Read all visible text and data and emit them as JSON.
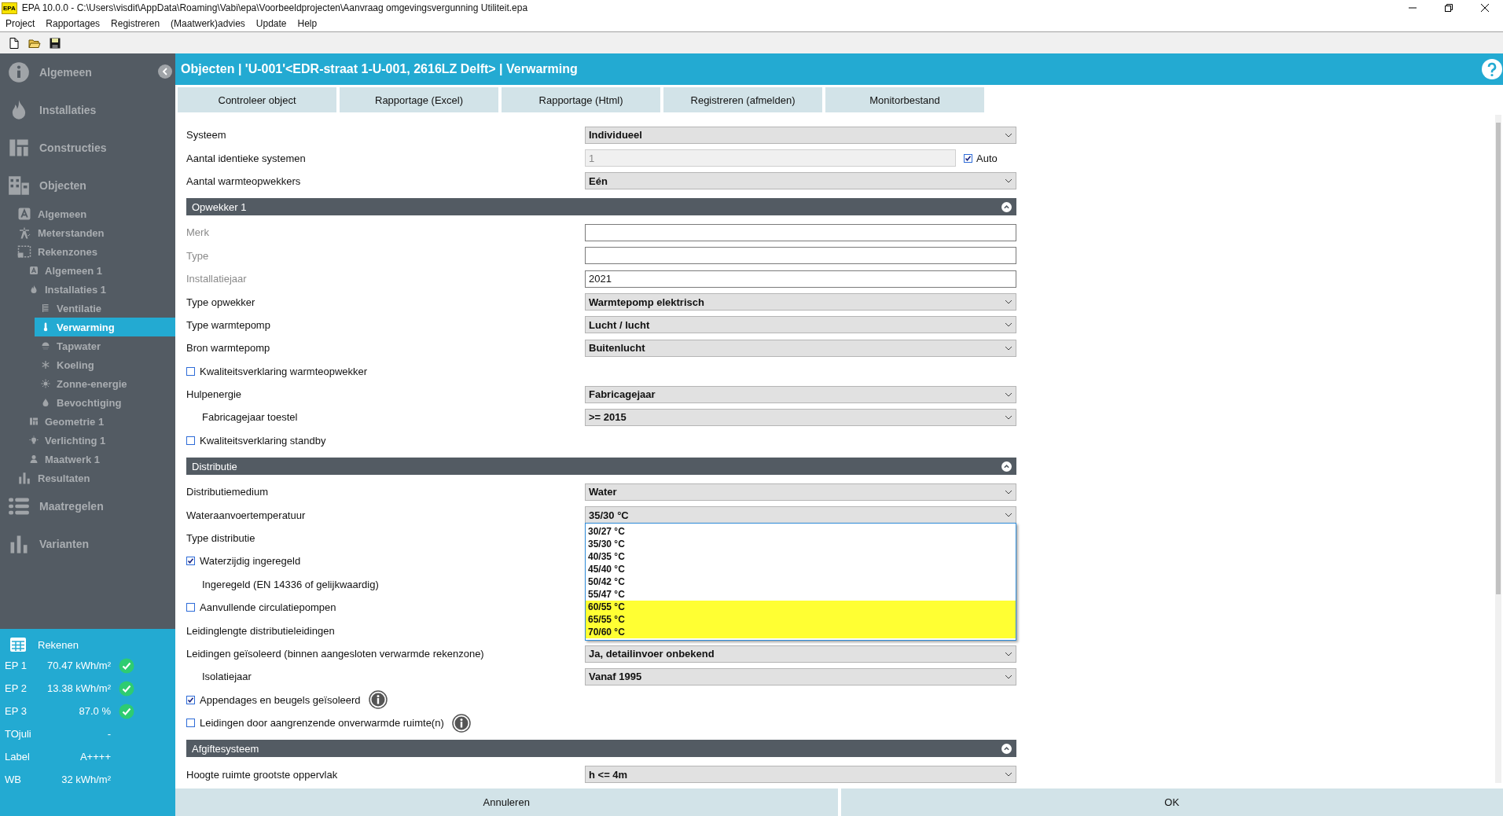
{
  "window": {
    "app_badge": "EPA",
    "title": "EPA 10.0.0 - C:\\Users\\visdit\\AppData\\Roaming\\Vabi\\epa\\Voorbeeldprojecten\\Aanvraag omgevingsvergunning Utiliteit.epa"
  },
  "menu": [
    "Project",
    "Rapportages",
    "Registreren",
    "(Maatwerk)advies",
    "Update",
    "Help"
  ],
  "sidebar": {
    "items": [
      {
        "label": "Algemeen",
        "selected": false
      },
      {
        "label": "Installaties",
        "selected": false
      },
      {
        "label": "Constructies",
        "selected": false
      },
      {
        "label": "Objecten",
        "selected": false,
        "children": [
          {
            "label": "Algemeen",
            "selected": false
          },
          {
            "label": "Meterstanden",
            "selected": false
          },
          {
            "label": "Rekenzones",
            "selected": false,
            "children": [
              {
                "label": "Algemeen 1",
                "selected": false
              },
              {
                "label": "Installaties 1",
                "selected": false,
                "children": [
                  {
                    "label": "Ventilatie",
                    "selected": false
                  },
                  {
                    "label": "Verwarming",
                    "selected": true
                  },
                  {
                    "label": "Tapwater",
                    "selected": false
                  },
                  {
                    "label": "Koeling",
                    "selected": false
                  },
                  {
                    "label": "Zonne-energie",
                    "selected": false
                  },
                  {
                    "label": "Bevochtiging",
                    "selected": false
                  }
                ]
              },
              {
                "label": "Geometrie 1",
                "selected": false
              },
              {
                "label": "Verlichting 1",
                "selected": false
              },
              {
                "label": "Maatwerk 1",
                "selected": false
              }
            ]
          },
          {
            "label": "Resultaten",
            "selected": false
          }
        ]
      },
      {
        "label": "Maatregelen",
        "selected": false
      },
      {
        "label": "Varianten",
        "selected": false
      }
    ]
  },
  "results": {
    "button": "Rekenen",
    "rows": [
      {
        "label": "EP 1",
        "value": "70.47 kWh/m²",
        "passed": true
      },
      {
        "label": "EP 2",
        "value": "13.38 kWh/m²",
        "passed": true
      },
      {
        "label": "EP 3",
        "value": "87.0 %",
        "passed": true
      },
      {
        "label": "TOjuli",
        "value": "-",
        "passed": false
      },
      {
        "label": "Label",
        "value": "A++++",
        "passed": false
      },
      {
        "label": "WB",
        "value": "32 kWh/m²",
        "passed": false
      }
    ]
  },
  "header": {
    "title": "Objecten | 'U-001'<EDR-straat 1-U-001, 2616LZ Delft> | Verwarming"
  },
  "actions": [
    "Controleer object",
    "Rapportage (Excel)",
    "Rapportage (Html)",
    "Registreren (afmelden)",
    "Monitorbestand"
  ],
  "form": {
    "rows": [
      {
        "kind": "select",
        "label": "Systeem",
        "value": "Individueel",
        "indented": false,
        "open": false
      },
      {
        "kind": "input",
        "label": "Aantal identieke systemen",
        "value": "1",
        "indented": false,
        "muted": false,
        "disabled": true,
        "option": {
          "label": "Auto",
          "checked": true
        }
      },
      {
        "kind": "select",
        "label": "Aantal warmteopwekkers",
        "value": "Eén",
        "indented": false,
        "open": false
      },
      {
        "kind": "section",
        "title": "Opwekker 1",
        "expanded": true
      },
      {
        "kind": "input",
        "label": "Merk",
        "indented": false,
        "muted": true,
        "disabled": false
      },
      {
        "kind": "input",
        "label": "Type",
        "indented": false,
        "muted": true,
        "disabled": false
      },
      {
        "kind": "input",
        "label": "Installatiejaar",
        "value": "2021",
        "indented": false,
        "muted": true,
        "disabled": false
      },
      {
        "kind": "select",
        "label": "Type opwekker",
        "value": "Warmtepomp elektrisch",
        "indented": false,
        "open": false
      },
      {
        "kind": "select",
        "label": "Type warmtepomp",
        "value": "Lucht / lucht",
        "indented": false,
        "open": false
      },
      {
        "kind": "select",
        "label": "Bron warmtepomp",
        "value": "Buitenlucht",
        "indented": false,
        "open": false
      },
      {
        "kind": "checkbox",
        "label": "Kwaliteitsverklaring warmteopwekker",
        "checked": false,
        "info": false
      },
      {
        "kind": "select",
        "label": "Hulpenergie",
        "value": "Fabricagejaar",
        "indented": false,
        "open": false
      },
      {
        "kind": "select",
        "label": "Fabricagejaar toestel",
        "value": ">= 2015",
        "indented": true,
        "open": false
      },
      {
        "kind": "checkbox",
        "label": "Kwaliteitsverklaring standby",
        "checked": false,
        "info": false
      },
      {
        "kind": "section",
        "title": "Distributie",
        "expanded": true
      },
      {
        "kind": "select",
        "label": "Distributiemedium",
        "value": "Water",
        "indented": false,
        "open": false
      },
      {
        "kind": "select",
        "label": "Wateraanvoertemperatuur",
        "value": "35/30 °C",
        "indented": false,
        "open": true,
        "options": [
          {
            "label": "30/27 °C",
            "highlighted": false
          },
          {
            "label": "35/30 °C",
            "highlighted": false
          },
          {
            "label": "40/35 °C",
            "highlighted": false
          },
          {
            "label": "45/40 °C",
            "highlighted": false
          },
          {
            "label": "50/42 °C",
            "highlighted": false
          },
          {
            "label": "55/47 °C",
            "highlighted": false
          },
          {
            "label": "60/55 °C",
            "highlighted": true
          },
          {
            "label": "65/55 °C",
            "highlighted": true
          },
          {
            "label": "70/60 °C",
            "highlighted": true
          }
        ]
      },
      {
        "kind": "label",
        "label": "Type distributie",
        "indented": false
      },
      {
        "kind": "checkbox",
        "label": "Waterzijdig ingeregeld",
        "checked": true,
        "info": false
      },
      {
        "kind": "label",
        "label": "Ingeregeld (EN 14336 of gelijkwaardig)",
        "indented": true
      },
      {
        "kind": "checkbox",
        "label": "Aanvullende circulatiepompen",
        "checked": false,
        "info": false
      },
      {
        "kind": "label",
        "label": "Leidinglengte distributieleidingen",
        "indented": false
      },
      {
        "kind": "select",
        "label": "Leidingen geïsoleerd (binnen aangesloten verwarmde rekenzone)",
        "value": "Ja, detailinvoer onbekend",
        "indented": false,
        "open": false
      },
      {
        "kind": "select",
        "label": "Isolatiejaar",
        "value": "Vanaf 1995",
        "indented": true,
        "open": false
      },
      {
        "kind": "checkbox",
        "label": "Appendages en beugels geïsoleerd",
        "checked": true,
        "info": true
      },
      {
        "kind": "checkbox",
        "label": "Leidingen door aangrenzende onverwarmde ruimte(n)",
        "checked": false,
        "info": true
      },
      {
        "kind": "section",
        "title": "Afgiftesysteem",
        "expanded": true
      },
      {
        "kind": "select",
        "label": "Hoogte ruimte grootste oppervlak",
        "value": "h <= 4m",
        "indented": false,
        "open": false
      }
    ]
  },
  "footer": {
    "buttons": [
      "Annuleren",
      "OK"
    ]
  }
}
